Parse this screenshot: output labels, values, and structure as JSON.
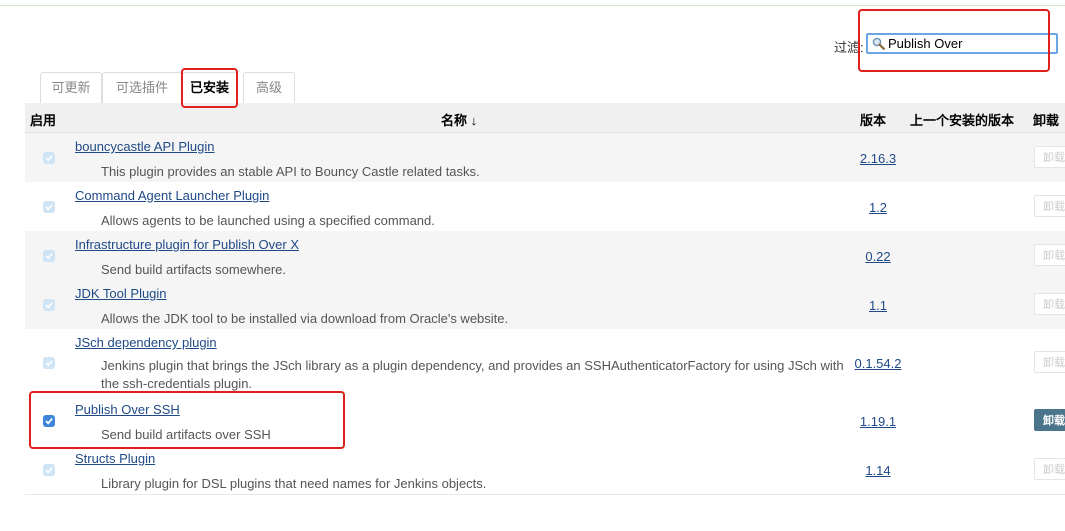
{
  "filter": {
    "label": "过滤:",
    "value": "Publish Over",
    "icon": "search-icon"
  },
  "tabs": [
    {
      "label": "可更新",
      "active": false
    },
    {
      "label": "可选插件",
      "active": false
    },
    {
      "label": "已安装",
      "active": true
    },
    {
      "label": "高级",
      "active": false
    }
  ],
  "table": {
    "headers": {
      "enabled": "启用",
      "name": "名称 ↓",
      "version": "版本",
      "previous": "上一个安装的版本",
      "uninstall": "卸载"
    },
    "rows": [
      {
        "name": "bouncycastle API Plugin",
        "desc": "This plugin provides an stable API to Bouncy Castle related tasks.",
        "version": "2.16.3",
        "checked": true,
        "editable": false,
        "uninstall": "卸载",
        "uninstall_enabled": false
      },
      {
        "name": "Command Agent Launcher Plugin",
        "desc": "Allows agents to be launched using a specified command.",
        "version": "1.2",
        "checked": true,
        "editable": false,
        "uninstall": "卸载",
        "uninstall_enabled": false
      },
      {
        "name": "Infrastructure plugin for Publish Over X",
        "desc": "Send build artifacts somewhere.",
        "version": "0.22",
        "checked": true,
        "editable": false,
        "uninstall": "卸载",
        "uninstall_enabled": false
      },
      {
        "name": "JDK Tool Plugin",
        "desc": "Allows the JDK tool to be installed via download from Oracle's website.",
        "version": "1.1",
        "checked": true,
        "editable": false,
        "uninstall": "卸载",
        "uninstall_enabled": false
      },
      {
        "name": "JSch dependency plugin",
        "desc": "Jenkins plugin that brings the JSch library as a plugin dependency, and provides an SSHAuthenticatorFactory for using JSch with the ssh-credentials plugin.",
        "version": "0.1.54.2",
        "checked": true,
        "editable": false,
        "uninstall": "卸载",
        "uninstall_enabled": false
      },
      {
        "name": "Publish Over SSH",
        "desc": "Send build artifacts over SSH",
        "version": "1.19.1",
        "checked": true,
        "editable": true,
        "uninstall": "卸载",
        "uninstall_enabled": true
      },
      {
        "name": "Structs Plugin",
        "desc": "Library plugin for DSL plugins that need names for Jenkins objects.",
        "version": "1.14",
        "checked": true,
        "editable": false,
        "uninstall": "卸载",
        "uninstall_enabled": false
      }
    ]
  },
  "colors": {
    "highlight": "#e0201c",
    "link": "#204a87",
    "uninstall_active": "#4b758b",
    "checkbox_on": "#3d86d9"
  }
}
